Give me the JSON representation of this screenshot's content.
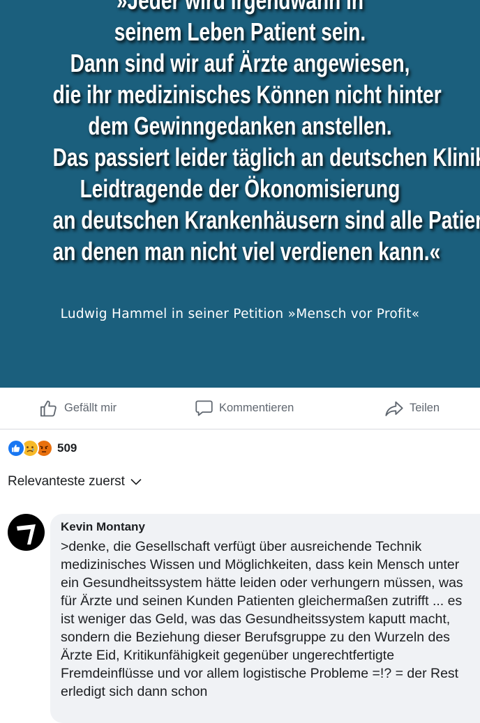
{
  "post": {
    "quote_lines": [
      "»Jeder wird irgendwann in",
      "seinem Leben Patient sein.",
      "Dann sind wir auf Ärzte angewiesen,",
      "die ihr medizinisches Können nicht hinter",
      "dem Gewinngedanken anstellen.",
      "Das passiert leider täglich an deutschen Kliniken.",
      "Leidtragende der Ökonomisierung",
      "an deutschen Krankenhäusern sind alle Patienten,",
      "an denen man nicht viel verdienen kann.«"
    ],
    "attribution": "Ludwig Hammel in seiner Petition »Mensch vor Profit«",
    "background_color": "#1b5f7d"
  },
  "actions": {
    "like_label": "Gefällt mir",
    "comment_label": "Kommentieren",
    "share_label": "Teilen"
  },
  "reactions": {
    "icons": [
      "like-icon",
      "sad-icon",
      "angry-icon"
    ],
    "count": "509"
  },
  "comments": {
    "sort_label": "Relevanteste zuerst",
    "items": [
      {
        "author": "Kevin Montany",
        "text": ">denke, die Gesellschaft verfügt über ausreichende Technik medizinisches Wissen und Möglichkeiten, dass kein Mensch unter ein Gesundheitssystem hätte leiden oder verhungern müssen, was für Ärzte und seinen Kunden Patienten gleichermaßen zutrifft ... es ist weniger das Geld, was das Gesundheitssystem kaputt macht, sondern die Beziehung dieser Berufsgruppe zu den Wurzeln des Ärzte Eid, Kritikunfähigkeit gegenüber ungerechtfertigte  Fremdeinflüsse und vor allem logistische Probleme =!? = der Rest erledigt sich dann schon"
      }
    ]
  }
}
